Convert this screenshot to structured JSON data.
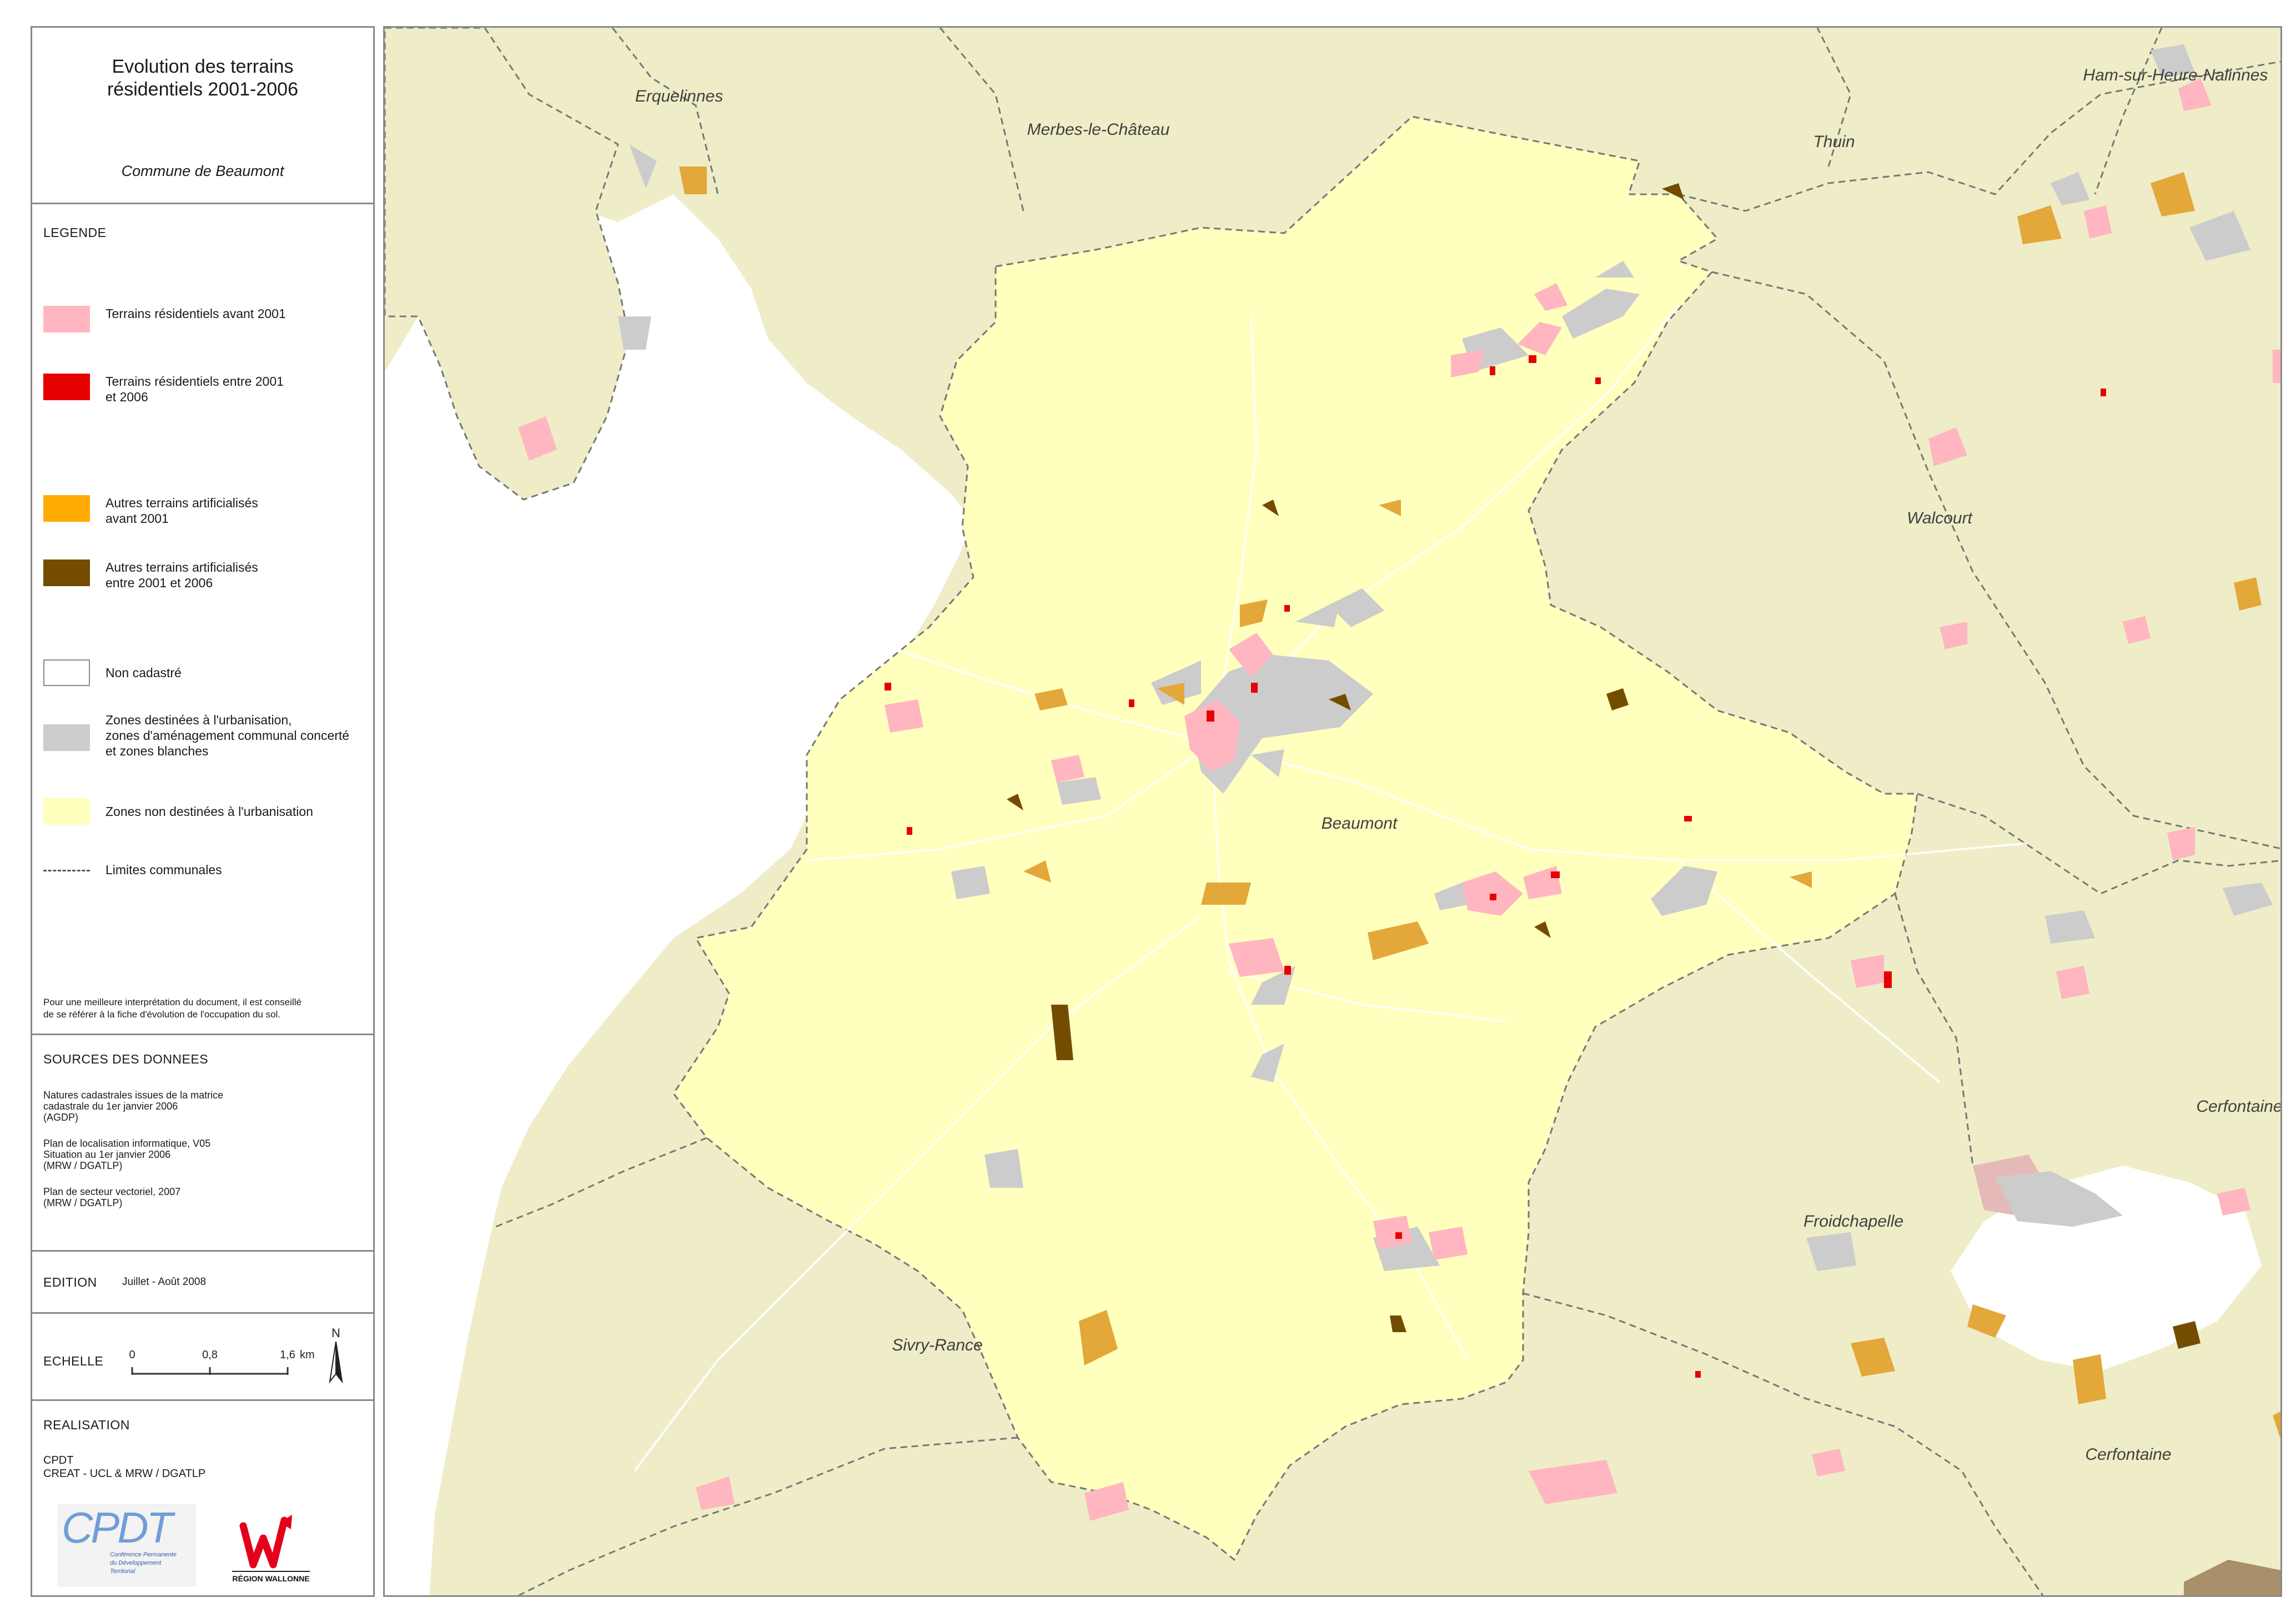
{
  "title": {
    "line1": "Evolution des terrains",
    "line2": "résidentiels 2001-2006",
    "subtitle": "Commune de Beaumont"
  },
  "legend": {
    "heading": "LEGENDE",
    "items": [
      {
        "lines": [
          "Terrains résidentiels avant 2001"
        ],
        "color": "#FFB6C1"
      },
      {
        "lines": [
          "Terrains résidentiels entre 2001",
          "et 2006"
        ],
        "color": "#E60000"
      },
      {
        "lines": [
          "Autres terrains artificialisés",
          "avant 2001"
        ],
        "color": "#FFAA00"
      },
      {
        "lines": [
          "Autres terrains artificialisés",
          "entre 2001 et 2006"
        ],
        "color": "#734C00"
      },
      {
        "lines": [
          "Non cadastré"
        ],
        "color": "#FFFFFF"
      },
      {
        "lines": [
          "Zones destinées à l'urbanisation,",
          "zones d'aménagement communal concerté",
          "et zones blanches"
        ],
        "color": "#CCCCCC"
      },
      {
        "lines": [
          "Zones non destinées à l'urbanisation"
        ],
        "color": "#FFFFBE"
      },
      {
        "lines": [
          "Limites communales"
        ],
        "color": "#555555"
      }
    ],
    "note": [
      "Pour une meilleure interprétation du document, il est conseillé",
      "de se référer à la fiche d'évolution de l'occupation du sol."
    ]
  },
  "sources": {
    "heading": "SOURCES DES DONNEES",
    "blocks": [
      [
        "Natures cadastrales issues de la matrice",
        "cadastrale du 1er janvier 2006",
        "(AGDP)"
      ],
      [
        "Plan de localisation informatique, V05",
        "Situation au 1er janvier 2006",
        "(MRW / DGATLP)"
      ],
      [
        "Plan de secteur vectoriel, 2007",
        "(MRW / DGATLP)"
      ]
    ]
  },
  "edition": {
    "label": "EDITION",
    "value": "Juillet - Août 2008"
  },
  "scale": {
    "label": "ECHELLE",
    "ticks": [
      "0",
      "0,8",
      "1,6"
    ],
    "unit": "km",
    "north": "N"
  },
  "realisation": {
    "label": "REALISATION",
    "lines": [
      "CPDT",
      "CREAT - UCL & MRW / DGATLP"
    ],
    "logo_cpdt_text": "CPDT",
    "logo_cpdt_caption": [
      "Conférence Permanente",
      "du Développement",
      "Territorial"
    ],
    "logo_region_caption": "RÉGION WALLONNE"
  },
  "map": {
    "places": [
      "Erquelinnes",
      "Merbes-le-Château",
      "Thuin",
      "Ham-sur-Heure-Nalinnes",
      "Walcourt",
      "Beaumont",
      "Cerfontaine",
      "Froidchapelle",
      "Sivry-Rance",
      "Cerfontaine"
    ],
    "colors": {
      "outside": "#EEEDC7",
      "commune": "#FFFFBE",
      "water": "#FFFFFF",
      "residential_before": "#FFB6C1",
      "residential_new": "#E60000",
      "artificial_before": "#E3A73A",
      "artificial_new": "#734C00",
      "urbanisation": "#CCCCCC",
      "boundary": "#777777"
    }
  }
}
